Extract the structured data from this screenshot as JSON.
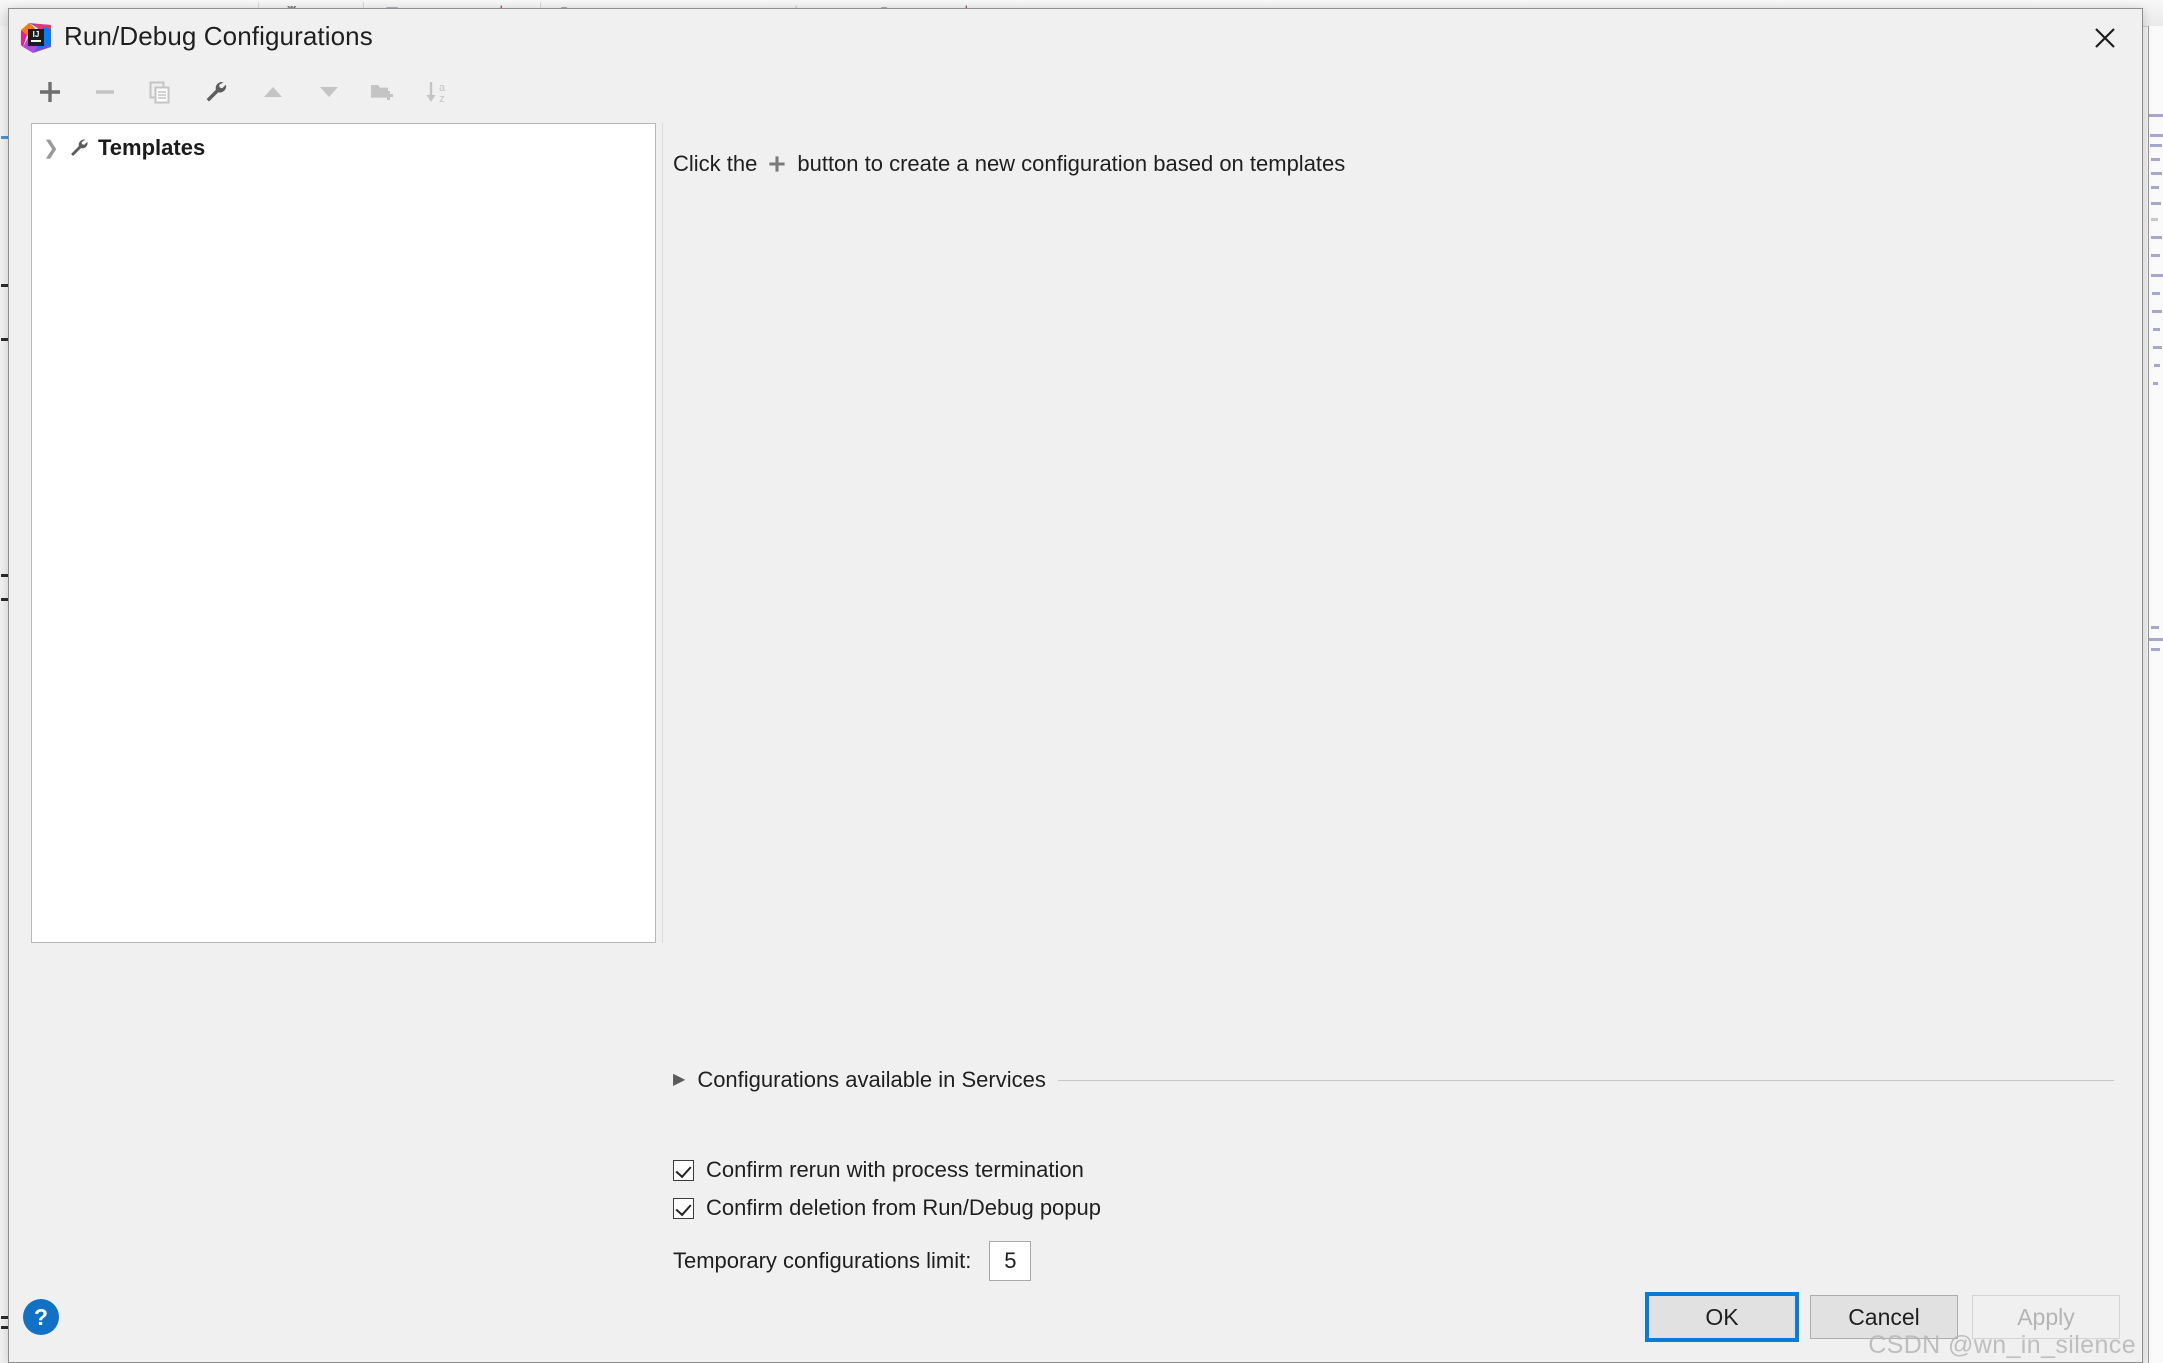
{
  "window": {
    "title": "Run/Debug Configurations",
    "app_icon": "intellij-idea-logo",
    "close_icon": "close-icon"
  },
  "toolbar": {
    "buttons": [
      {
        "name": "add-configuration-button",
        "icon": "plus-icon",
        "label": "Add New Configuration",
        "enabled": true
      },
      {
        "name": "remove-configuration-button",
        "icon": "minus-icon",
        "label": "Remove Configuration",
        "enabled": false
      },
      {
        "name": "copy-configuration-button",
        "icon": "copy-icon",
        "label": "Copy Configuration",
        "enabled": false
      },
      {
        "name": "edit-templates-button",
        "icon": "wrench-icon",
        "label": "Edit Templates",
        "enabled": true
      },
      {
        "name": "move-up-button",
        "icon": "arrow-up-icon",
        "label": "Move Up",
        "enabled": false
      },
      {
        "name": "move-down-button",
        "icon": "arrow-down-icon",
        "label": "Move Down",
        "enabled": false
      },
      {
        "name": "new-folder-button",
        "icon": "folder-add-icon",
        "label": "Create New Folder",
        "enabled": false
      },
      {
        "name": "sort-configurations-button",
        "icon": "sort-alpha-icon",
        "label": "Sort Configurations",
        "enabled": false
      }
    ]
  },
  "tree": {
    "chevron_icon": "chevron-right-icon",
    "node_icon": "wrench-icon",
    "templates_label": "Templates"
  },
  "main": {
    "hint_before": "Click the",
    "hint_plus_icon": "plus-icon",
    "hint_after": "button to create a new configuration based on templates"
  },
  "services": {
    "arrow_icon": "triangle-right-icon",
    "label": "Configurations available in Services",
    "expanded": false
  },
  "options": {
    "confirm_rerun": {
      "label": "Confirm rerun with process termination",
      "checked": true
    },
    "confirm_deletion": {
      "label": "Confirm deletion from Run/Debug popup",
      "checked": true
    },
    "temporary_limit": {
      "label": "Temporary configurations limit:",
      "value": "5"
    }
  },
  "footer": {
    "help_label": "?",
    "ok_label": "OK",
    "cancel_label": "Cancel",
    "apply_label": "Apply",
    "apply_enabled": false
  },
  "watermark": "CSDN @wn_in_silence",
  "colors": {
    "accent": "#0a7bd8",
    "help_blue": "#1071c5",
    "dialog_bg": "#f0f0f0",
    "list_bg": "#ffffff",
    "border": "#b8b8b8",
    "disabled_icon": "#c4c4c4",
    "enabled_icon": "#6e6e6e"
  }
}
